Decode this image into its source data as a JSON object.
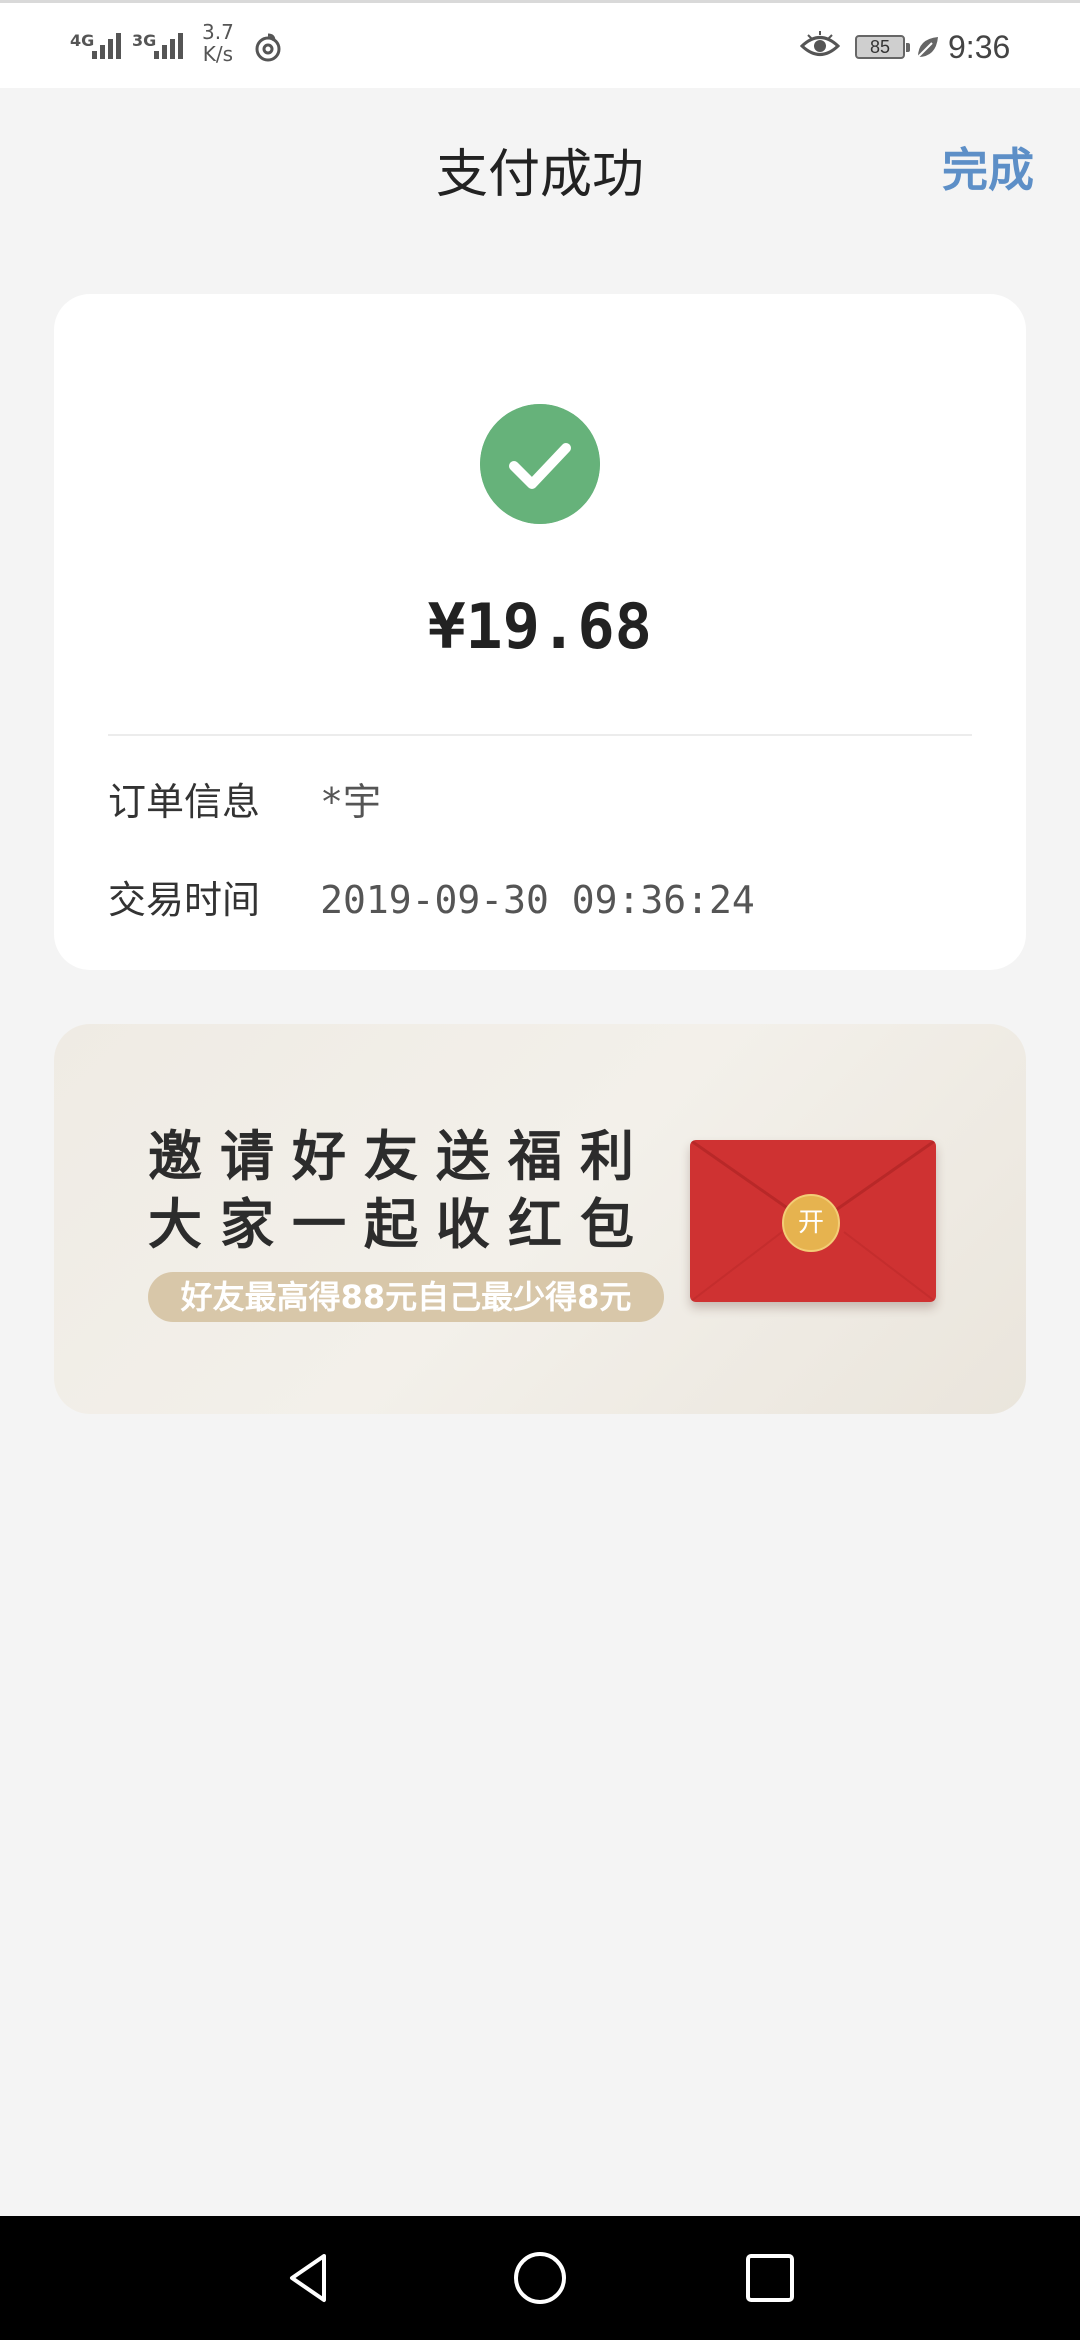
{
  "status_bar": {
    "signal1_label": "4G",
    "signal2_label": "3G",
    "speed_value": "3.7",
    "speed_unit": "K/s",
    "battery": "85",
    "time": "9:36",
    "icons": [
      "signal-4g-icon",
      "signal-3g-icon",
      "netease-music-icon",
      "eye-icon",
      "battery-icon",
      "leaf-icon"
    ]
  },
  "header": {
    "title": "支付成功",
    "done_label": "完成"
  },
  "result": {
    "status_icon": "check-circle-icon",
    "amount": "¥19.68",
    "order_label": "订单信息",
    "order_value": "*宇",
    "time_label": "交易时间",
    "time_value": "2019-09-30 09:36:24"
  },
  "banner": {
    "line1": "邀请好友送福利",
    "line2": "大家一起收红包",
    "subline": "好友最高得88元自己最少得8元",
    "seal_text": "开"
  },
  "colors": {
    "accent": "#5d8fc7",
    "success": "#66b27a",
    "envelope": "#cf3232",
    "seal": "#e6b34f",
    "pill": "#d8c7a9"
  },
  "nav": {
    "icons": [
      "back-icon",
      "home-icon",
      "recents-icon"
    ]
  }
}
